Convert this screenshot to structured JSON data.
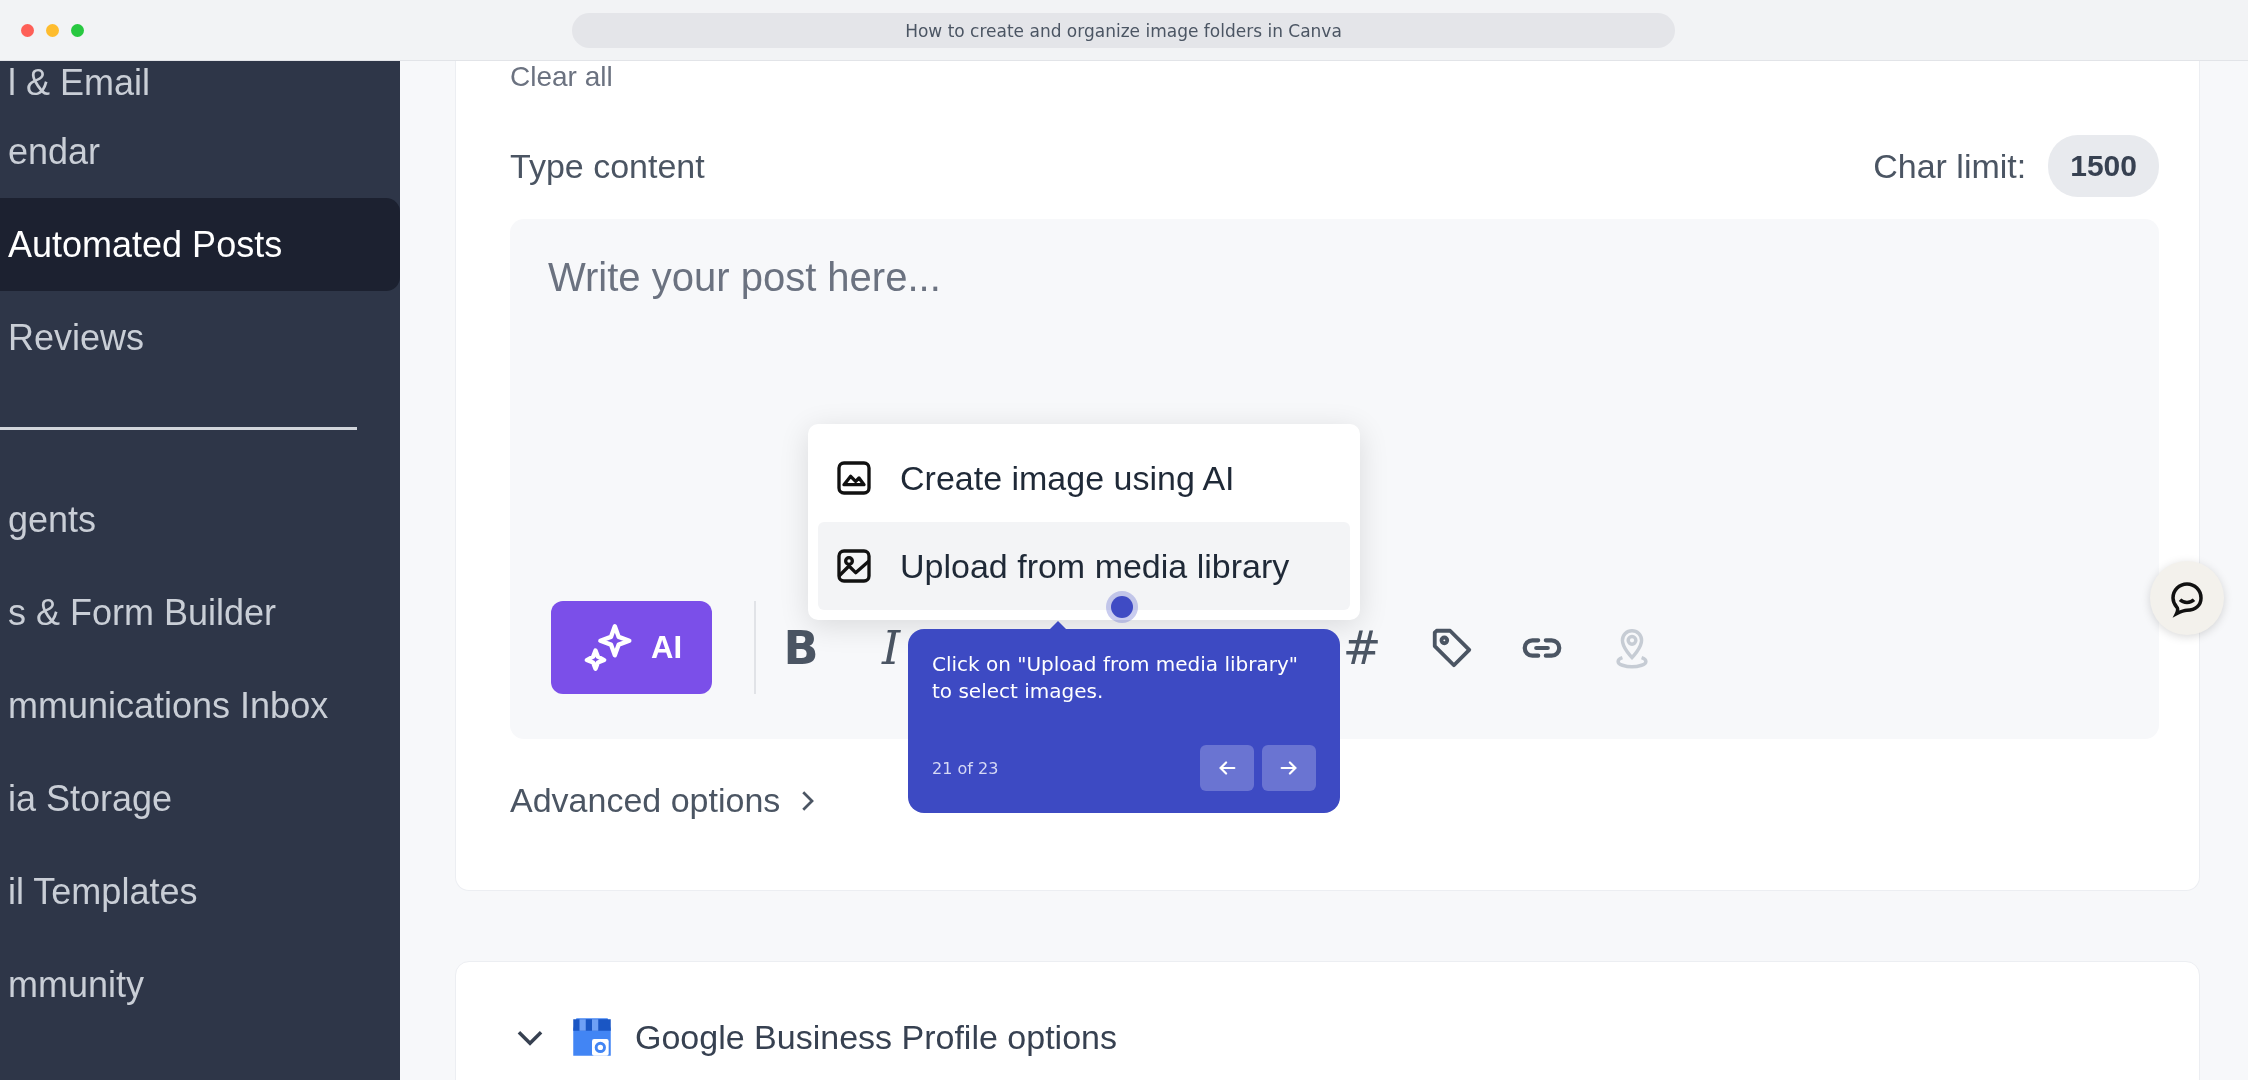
{
  "browser": {
    "title": "How to create and organize image folders in Canva"
  },
  "sidebar": {
    "items": [
      {
        "label": "l & Email",
        "selected": false,
        "divider_after": false
      },
      {
        "label": "endar",
        "selected": false,
        "divider_after": false
      },
      {
        "label": "Automated Posts",
        "selected": true,
        "divider_after": false
      },
      {
        "label": "Reviews",
        "selected": false,
        "divider_after": true
      },
      {
        "label": "gents",
        "selected": false,
        "divider_after": false
      },
      {
        "label": "s & Form Builder",
        "selected": false,
        "divider_after": false
      },
      {
        "label": "mmunications Inbox",
        "selected": false,
        "divider_after": false
      },
      {
        "label": "ia Storage",
        "selected": false,
        "divider_after": false
      },
      {
        "label": "il Templates",
        "selected": false,
        "divider_after": false
      },
      {
        "label": "mmunity",
        "selected": false,
        "divider_after": false
      }
    ]
  },
  "composer": {
    "clear_link": "Clear all",
    "label": "Type content",
    "char_limit_label": "Char limit:",
    "char_limit": "1500",
    "placeholder": "Write your post here...",
    "ai_button": "AI",
    "toolbar": [
      {
        "kind": "bold",
        "label": "B",
        "disabled": false
      },
      {
        "kind": "italic",
        "label": "I",
        "disabled": false
      },
      {
        "kind": "hash",
        "label": "#",
        "disabled": false
      },
      {
        "kind": "tag",
        "disabled": false
      },
      {
        "kind": "link",
        "disabled": false
      },
      {
        "kind": "location",
        "disabled": true
      }
    ],
    "advanced": "Advanced options"
  },
  "image_menu": {
    "items": [
      {
        "kind": "ai",
        "label": "Create image using AI",
        "selected": false
      },
      {
        "kind": "upload",
        "label": "Upload from media library",
        "selected": true
      }
    ]
  },
  "tooltip": {
    "text": "Click on \"Upload from media library\" to select images.",
    "step": "21 of 23"
  },
  "gbp_section": {
    "title": "Google Business Profile options",
    "expanded": true
  }
}
